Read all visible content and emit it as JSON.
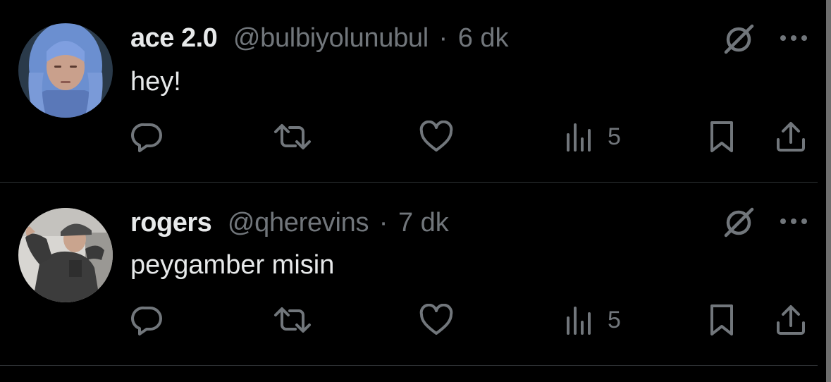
{
  "tweets": [
    {
      "display_name": "ace 2.0",
      "handle": "@bulbiyolunubul",
      "separator": "·",
      "time": "6 dk",
      "text": "hey!",
      "views_count": "5",
      "avatar": "avatar-blue-hair"
    },
    {
      "display_name": "rogers",
      "handle": "@qherevins",
      "separator": "·",
      "time": "7 dk",
      "text": "peygamber misin",
      "views_count": "5",
      "avatar": "avatar-person-cap"
    }
  ],
  "icons": {
    "grok": "grok-icon",
    "more": "more-options-icon",
    "reply": "reply-icon",
    "retweet": "retweet-icon",
    "like": "like-icon",
    "views": "views-icon",
    "bookmark": "bookmark-icon",
    "share": "share-icon"
  },
  "colors": {
    "background": "#000000",
    "primary_text": "#e7e9ea",
    "secondary_text": "#71767b",
    "divider": "#2f3336"
  }
}
